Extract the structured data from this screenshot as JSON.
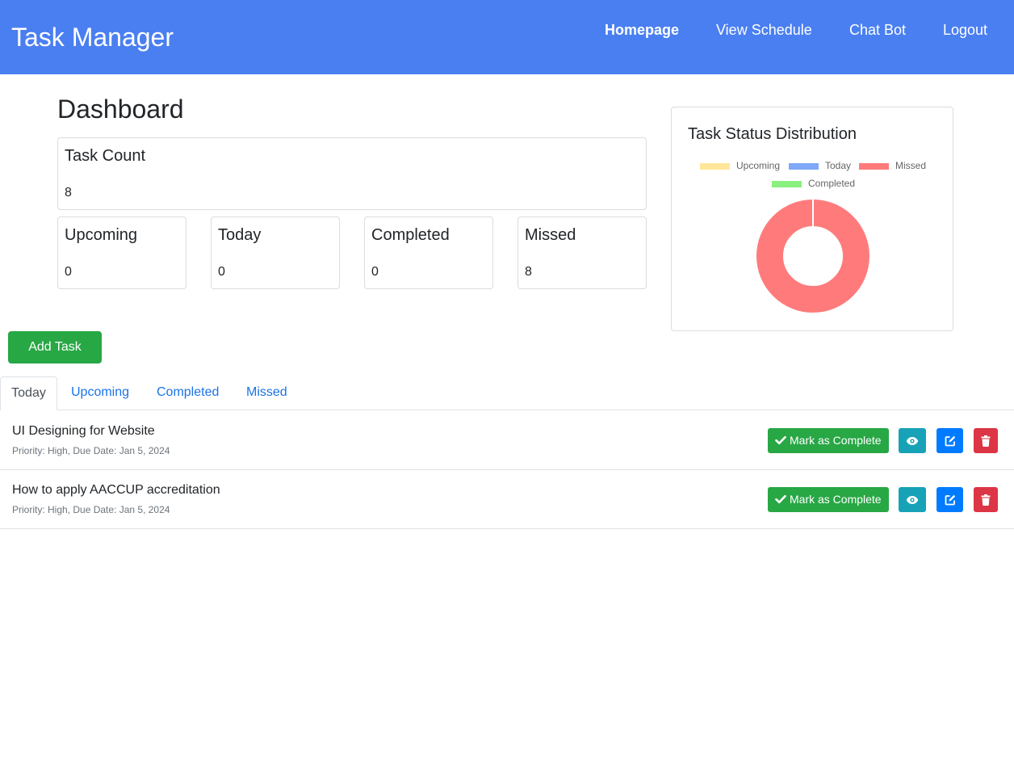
{
  "navbar": {
    "brand": "Task Manager",
    "links": [
      {
        "label": "Homepage",
        "active": true
      },
      {
        "label": "View Schedule",
        "active": false
      },
      {
        "label": "Chat Bot",
        "active": false
      },
      {
        "label": "Logout",
        "active": false
      }
    ]
  },
  "dashboard": {
    "title": "Dashboard",
    "task_count": {
      "label": "Task Count",
      "value": "8"
    },
    "stats": [
      {
        "label": "Upcoming",
        "value": "0"
      },
      {
        "label": "Today",
        "value": "0"
      },
      {
        "label": "Completed",
        "value": "0"
      },
      {
        "label": "Missed",
        "value": "8"
      }
    ]
  },
  "chart": {
    "title": "Task Status Distribution",
    "legend": [
      "Upcoming",
      "Today",
      "Missed",
      "Completed"
    ]
  },
  "chart_data": {
    "type": "pie",
    "title": "Task Status Distribution",
    "categories": [
      "Upcoming",
      "Today",
      "Missed",
      "Completed"
    ],
    "values": [
      0,
      0,
      8,
      0
    ],
    "colors": [
      "#ffe699",
      "#7fa8f8",
      "#ff7b7b",
      "#8af07e"
    ],
    "legend_position": "top"
  },
  "add_task_label": "Add Task",
  "tabs": [
    "Today",
    "Upcoming",
    "Completed",
    "Missed"
  ],
  "active_tab": "Today",
  "tasks": [
    {
      "title": "UI Designing for Website",
      "meta": "Priority: High, Due Date: Jan 5, 2024",
      "complete_label": "Mark as Complete"
    },
    {
      "title": "How to apply AACCUP accreditation",
      "meta": "Priority: High, Due Date: Jan 5, 2024",
      "complete_label": "Mark as Complete"
    }
  ],
  "colors": {
    "navbar": "#4a7ff1",
    "success": "#28a745",
    "info": "#17a2b8",
    "primary": "#007bff",
    "danger": "#dc3545",
    "link": "#1a73e8"
  },
  "icons": {
    "complete": "check-icon",
    "view": "eye-icon",
    "edit": "edit-icon",
    "delete": "trash-icon"
  }
}
